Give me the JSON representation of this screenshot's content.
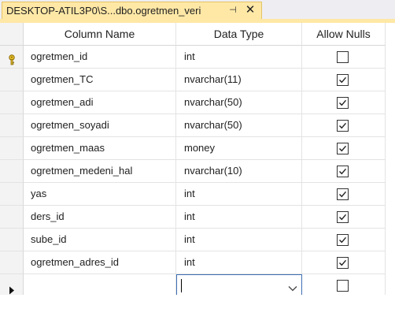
{
  "tab": {
    "title": "DESKTOP-ATIL3P0\\S...dbo.ogretmen_veri",
    "pin_glyph": "⊣",
    "close_glyph": "✕"
  },
  "columns": {
    "name": "Column Name",
    "type": "Data Type",
    "nulls": "Allow Nulls"
  },
  "rows": [
    {
      "name": "ogretmen_id",
      "type": "int",
      "allow_nulls": false,
      "primary_key": true
    },
    {
      "name": "ogretmen_TC",
      "type": "nvarchar(11)",
      "allow_nulls": true,
      "primary_key": false
    },
    {
      "name": "ogretmen_adi",
      "type": "nvarchar(50)",
      "allow_nulls": true,
      "primary_key": false
    },
    {
      "name": "ogretmen_soyadi",
      "type": "nvarchar(50)",
      "allow_nulls": true,
      "primary_key": false
    },
    {
      "name": "ogretmen_maas",
      "type": "money",
      "allow_nulls": true,
      "primary_key": false
    },
    {
      "name": "ogretmen_medeni_hal",
      "type": "nvarchar(10)",
      "allow_nulls": true,
      "primary_key": false
    },
    {
      "name": "yas",
      "type": "int",
      "allow_nulls": true,
      "primary_key": false
    },
    {
      "name": "ders_id",
      "type": "int",
      "allow_nulls": true,
      "primary_key": false
    },
    {
      "name": "sube_id",
      "type": "int",
      "allow_nulls": true,
      "primary_key": false
    },
    {
      "name": "ogretmen_adres_id",
      "type": "int",
      "allow_nulls": true,
      "primary_key": false
    }
  ],
  "new_row": {
    "name": "",
    "type": "",
    "allow_nulls": false
  },
  "colors": {
    "tab_bg": "#ffe8a6",
    "editor_border": "#3e6fb3"
  },
  "icons": {
    "primary_key": "key-icon",
    "current_row": "row-arrow-icon",
    "dropdown": "chevron-down-icon"
  }
}
